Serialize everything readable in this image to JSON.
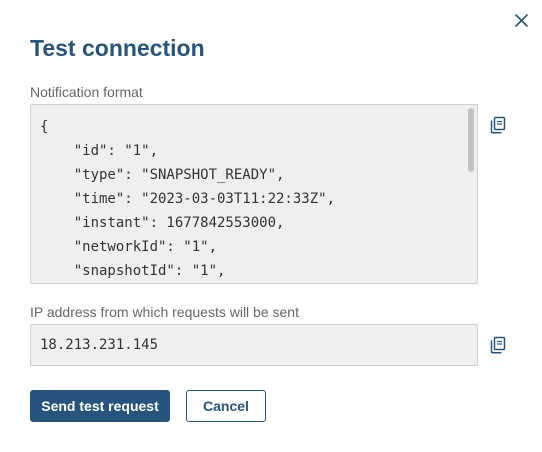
{
  "dialog": {
    "title": "Test connection",
    "notification_format_label": "Notification format",
    "notification_format_json": "{\n    \"id\": \"1\",\n    \"type\": \"SNAPSHOT_READY\",\n    \"time\": \"2023-03-03T11:22:33Z\",\n    \"instant\": 1677842553000,\n    \"networkId\": \"1\",\n    \"snapshotId\": \"1\",",
    "ip_label": "IP address from which requests will be sent",
    "ip_value": "18.213.231.145",
    "send_button": "Send test request",
    "cancel_button": "Cancel"
  },
  "icons": {
    "close": "close-icon",
    "copy": "copy-icon"
  },
  "colors": {
    "primary": "#27547f",
    "field_background": "#efefef",
    "field_border": "#cfcfcf",
    "label_text": "#666666"
  }
}
